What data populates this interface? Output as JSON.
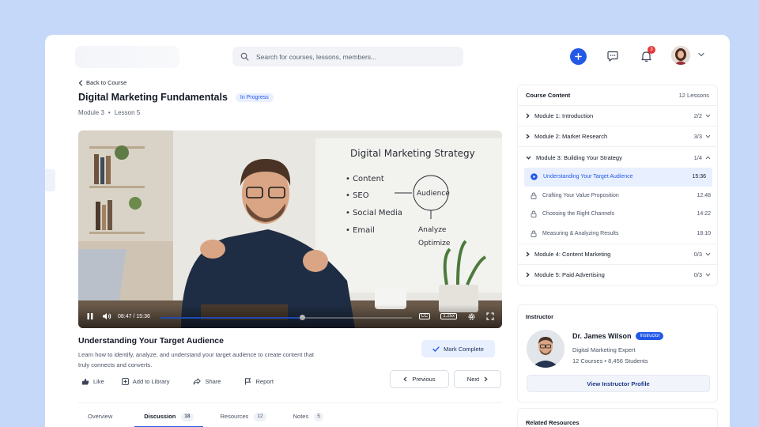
{
  "header": {
    "search_placeholder": "Search for courses, lessons, members...",
    "notification_count": "3"
  },
  "lesson": {
    "back_label": "Back to Course",
    "course_title": "Digital Marketing Fundamentals",
    "status": "In Progress",
    "module": "Module 3",
    "lesson_no": "Lesson 5",
    "title": "Understanding Your Target Audience",
    "description": "Learn how to identify, analyze, and understand your target audience to create content that truly connects and converts.",
    "mark_complete": "Mark Complete",
    "previous": "Previous",
    "next": "Next"
  },
  "video": {
    "time": "08:47 / 15:36",
    "progress_fraction": 0.563,
    "speed": "1.25x",
    "cc": "CC",
    "whiteboard": {
      "heading": "Digital Marketing Strategy",
      "items": [
        "• Content",
        "• SEO",
        "• Social Media",
        "• Email"
      ],
      "circle": "Audience",
      "analyze": "Analyze",
      "optimize": "Optimize"
    }
  },
  "actions": {
    "like": "Like",
    "add_library": "Add to Library",
    "share": "Share",
    "report": "Report"
  },
  "tabs": [
    {
      "label": "Overview",
      "count": ""
    },
    {
      "label": "Discussion",
      "count": "18"
    },
    {
      "label": "Resources",
      "count": "12"
    },
    {
      "label": "Notes",
      "count": "5"
    }
  ],
  "course_content": {
    "title": "Course Content",
    "lessons_count": "12 Lessons",
    "modules": [
      {
        "label": "Module 1: Introduction",
        "progress": "2/2"
      },
      {
        "label": "Module 2: Market Research",
        "progress": "3/3"
      },
      {
        "label": "Module 3: Building Your Strategy",
        "progress": "1/4"
      },
      {
        "label": "Module 4: Content Marketing",
        "progress": "0/3"
      },
      {
        "label": "Module 5: Paid Advertising",
        "progress": "0/3"
      }
    ],
    "module3_lessons": [
      {
        "label": "Understanding Your Target Audience",
        "duration": "15:36"
      },
      {
        "label": "Crafting Your Value Proposition",
        "duration": "12:48"
      },
      {
        "label": "Choosing the Right Channels",
        "duration": "14:22"
      },
      {
        "label": "Measuring & Analyzing Results",
        "duration": "18:10"
      }
    ]
  },
  "instructor": {
    "heading": "Instructor",
    "name": "Dr. James Wilson",
    "badge": "Instructor",
    "role": "Digital Marketing Expert",
    "stats": "12 Courses • 8,456 Students",
    "view_profile": "View Instructor Profile"
  },
  "related": {
    "heading": "Related Resources"
  },
  "colors": {
    "accent": "#2459e8",
    "background": "#c5d8fa",
    "badge_bg": "#e8efff",
    "notification": "#e5383b"
  }
}
